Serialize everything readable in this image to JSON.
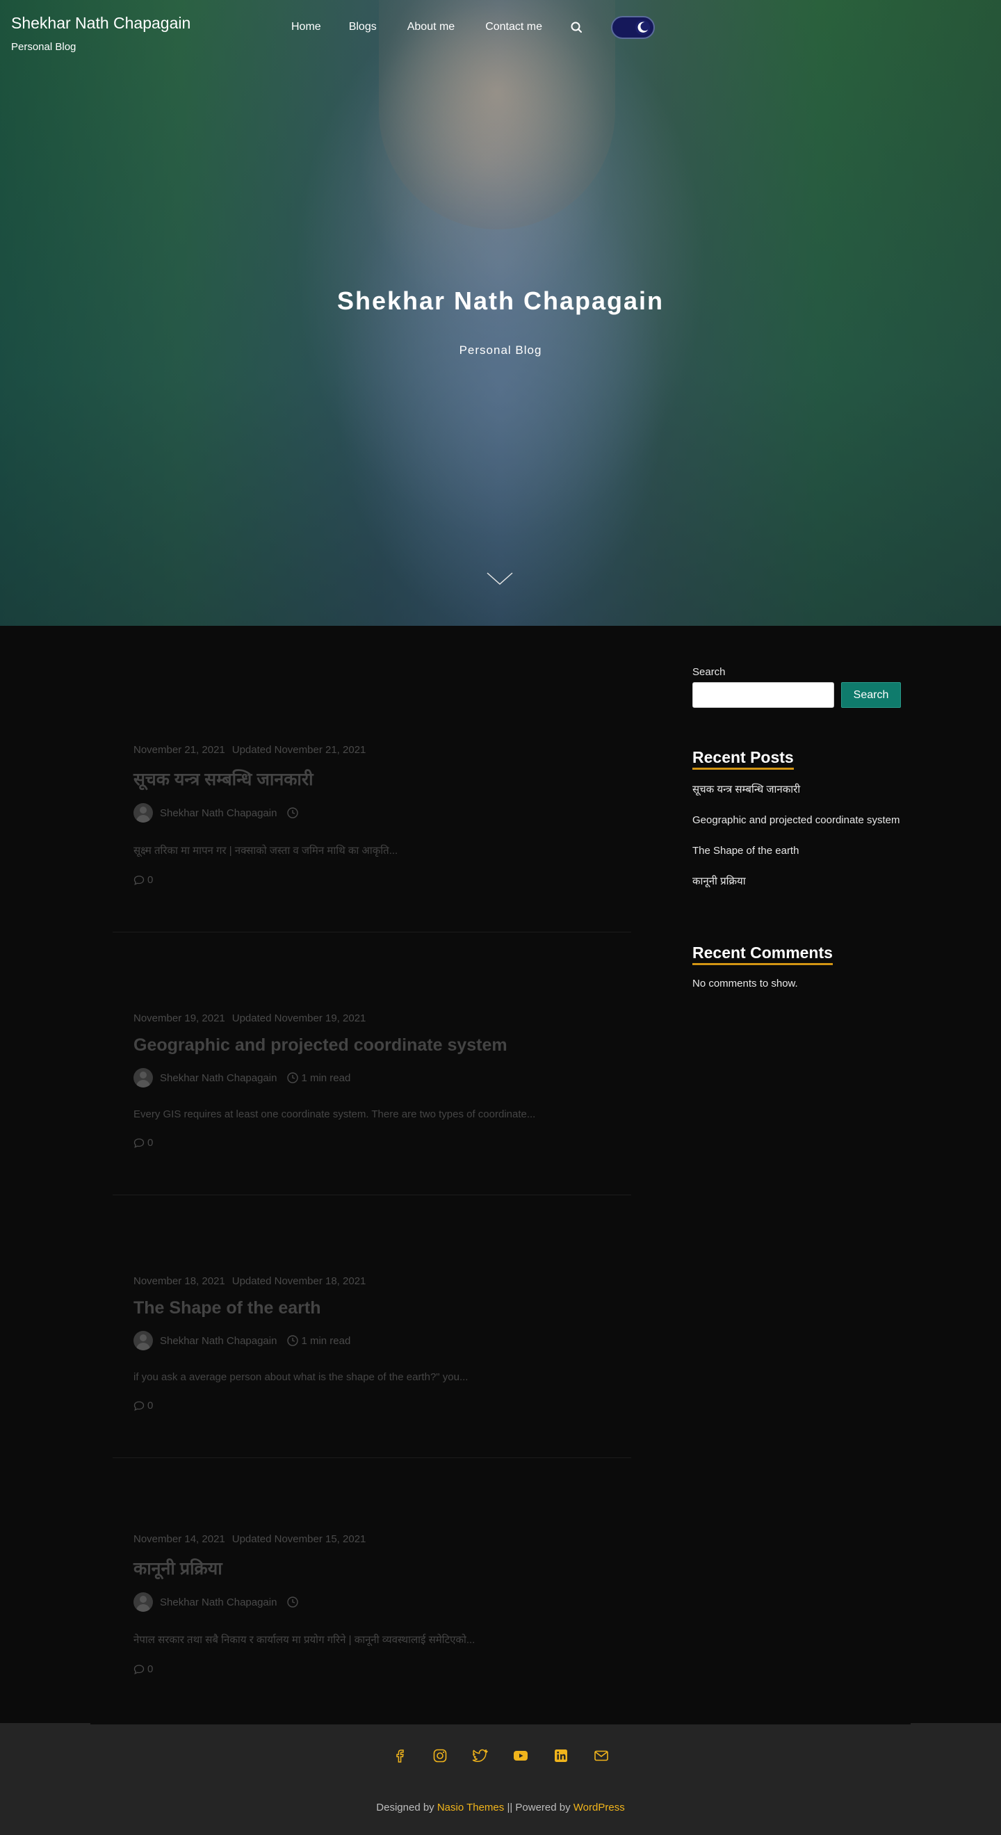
{
  "site": {
    "title": "Shekhar Nath Chapagain",
    "tagline": "Personal Blog"
  },
  "nav": {
    "items": [
      {
        "label": "Home"
      },
      {
        "label": "Blogs"
      },
      {
        "label": "About me"
      },
      {
        "label": "Contact me"
      }
    ],
    "search_icon": "search-icon",
    "theme_toggle_icon": "moon-icon"
  },
  "hero": {
    "title": "Shekhar Nath Chapagain",
    "subtitle": "Personal Blog",
    "scroll_icon": "chevron-down-icon"
  },
  "posts": [
    {
      "date": "November 21, 2021",
      "updated": "Updated November 21, 2021",
      "title": "सूचक यन्त्र सम्बन्धि जानकारी",
      "author": "Shekhar Nath Chapagain",
      "read_time": "",
      "excerpt": "सूक्ष्म तरिका मा मापन गर | नक्साको जस्ता व जमिन माथि का आकृति...",
      "comments": "0"
    },
    {
      "date": "November 19, 2021",
      "updated": "Updated November 19, 2021",
      "title": "Geographic and projected coordinate system",
      "author": "Shekhar Nath Chapagain",
      "read_time": "1 min read",
      "excerpt": "Every GIS requires at least one coordinate system. There are two types of coordinate...",
      "comments": "0"
    },
    {
      "date": "November 18, 2021",
      "updated": "Updated November 18, 2021",
      "title": "The Shape of the earth",
      "author": "Shekhar Nath Chapagain",
      "read_time": "1 min read",
      "excerpt": "if you ask a average person about what is the shape of the earth?\" you...",
      "comments": "0"
    },
    {
      "date": "November 14, 2021",
      "updated": "Updated November 15, 2021",
      "title": "कानूनी प्रक्रिया",
      "author": "Shekhar Nath Chapagain",
      "read_time": "",
      "excerpt": "नेपाल सरकार तथा सबै निकाय र कार्यालय मा प्रयोग गरिने | कानूनी व्यवस्थालाई समेटिएको...",
      "comments": "0"
    }
  ],
  "sidebar": {
    "search_label": "Search",
    "search_value": "",
    "search_button": "Search",
    "recent_posts_heading": "Recent Posts",
    "recent_posts": [
      {
        "label": "सूचक यन्त्र सम्बन्धि जानकारी"
      },
      {
        "label": "Geographic and projected coordinate system"
      },
      {
        "label": "The Shape of the earth"
      },
      {
        "label": "कानूनी प्रक्रिया"
      }
    ],
    "recent_comments_heading": "Recent Comments",
    "no_comments": "No comments to show."
  },
  "footer": {
    "social_icons": [
      "facebook-icon",
      "instagram-icon",
      "twitter-icon",
      "youtube-icon",
      "linkedin-icon",
      "mail-icon"
    ],
    "designed_by_prefix": "Designed by ",
    "theme_link": "Nasio Themes",
    "separator": " || Powered by ",
    "wordpress_link": "WordPress"
  },
  "colors": {
    "background": "#0b0b0b",
    "accent_teal": "#0f7b6c",
    "accent_gold": "#d29514",
    "footer_link": "#f0b41c",
    "toggle_bg": "#15185a"
  }
}
